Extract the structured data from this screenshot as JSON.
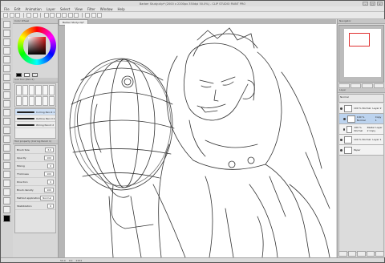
{
  "app": {
    "title": "Barber Study.clip* (2000 x 2200px 350dpi 50.0%) - CLIP STUDIO PAINT PRO"
  },
  "menu": [
    "File",
    "Edit",
    "Animation",
    "Layer",
    "Select",
    "View",
    "Filter",
    "Window",
    "Help"
  ],
  "document_tab": "Barber Study.clip*",
  "panels": {
    "color_wheel_tab": "Color Wheel",
    "subtool_tab": "Sub Tool (Pencil)",
    "brushes": [
      {
        "label": "Colring Pencil 1"
      },
      {
        "label": "Outline Pencil 2"
      },
      {
        "label": "Wiring Pencil 2"
      }
    ],
    "tool_property_tab": "Tool property (Colring Pencil 1)",
    "properties": [
      {
        "label": "Brush Size",
        "value": "3.0"
      },
      {
        "label": "Opacity",
        "value": "100"
      },
      {
        "label": "Mixing",
        "value": "0"
      },
      {
        "label": "Thickness",
        "value": "100"
      },
      {
        "label": "Direction",
        "value": "0"
      },
      {
        "label": "Brush density",
        "value": "100"
      },
      {
        "label": "Method application",
        "value": "Normal"
      },
      {
        "label": "Stabilization",
        "value": "6"
      }
    ],
    "navigator_tab": "Navigator",
    "layer_tab": "Layer",
    "layer_blend": "Normal",
    "layers": [
      {
        "name": "100 % Normal",
        "sub": "Layer 2",
        "selected": false,
        "child": false
      },
      {
        "name": "100 % Normal",
        "sub": "Copy 1",
        "selected": true,
        "child": true
      },
      {
        "name": "100 % Normal",
        "sub": "Raster Layer 2 Copy",
        "selected": false,
        "child": true
      },
      {
        "name": "100 % Normal",
        "sub": "Layer 1",
        "selected": false,
        "child": false
      },
      {
        "name": "Paper",
        "sub": "",
        "selected": false,
        "child": false
      }
    ]
  },
  "status": {
    "zoom": "50.0",
    "rotation": "0.0",
    "coords": "2154"
  },
  "colors": {
    "main_color": "#000000",
    "sub_color": "#ffffff",
    "accent": "#e03030"
  }
}
